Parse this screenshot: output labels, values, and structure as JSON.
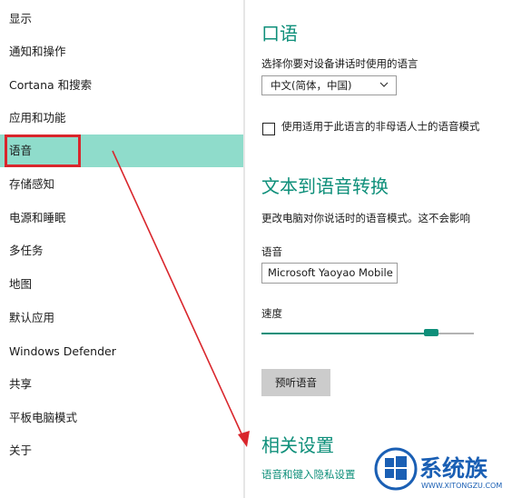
{
  "sidebar": {
    "items": [
      {
        "label": "显示"
      },
      {
        "label": "通知和操作"
      },
      {
        "label": "Cortana 和搜索"
      },
      {
        "label": "应用和功能"
      },
      {
        "label": "语音"
      },
      {
        "label": "存储感知"
      },
      {
        "label": "电源和睡眠"
      },
      {
        "label": "多任务"
      },
      {
        "label": "地图"
      },
      {
        "label": "默认应用"
      },
      {
        "label": "Windows Defender"
      },
      {
        "label": "共享"
      },
      {
        "label": "平板电脑模式"
      },
      {
        "label": "关于"
      }
    ],
    "selected_index": 4
  },
  "speech": {
    "title": "口语",
    "language_prompt": "选择你要对设备讲话时使用的语言",
    "language_value": "中文(简体，中国)",
    "checkbox_label": "使用适用于此语言的非母语人士的语音模式",
    "checkbox_checked": false
  },
  "tts": {
    "title": "文本到语音转换",
    "description": "更改电脑对你说话时的语音模式。这不会影响",
    "voice_label": "语音",
    "voice_value": "Microsoft Yaoyao Mobile",
    "speed_label": "速度",
    "speed_value": 0.8,
    "preview_label": "预听语音"
  },
  "related": {
    "title": "相关设置",
    "link": "语音和键入隐私设置"
  },
  "watermark": {
    "brand": "系统族",
    "url": "WWW.XITONGZU.COM"
  },
  "colors": {
    "accent": "#0e8f7a",
    "selected_bg": "#8fdccb",
    "annotation_red": "#d9262c"
  }
}
